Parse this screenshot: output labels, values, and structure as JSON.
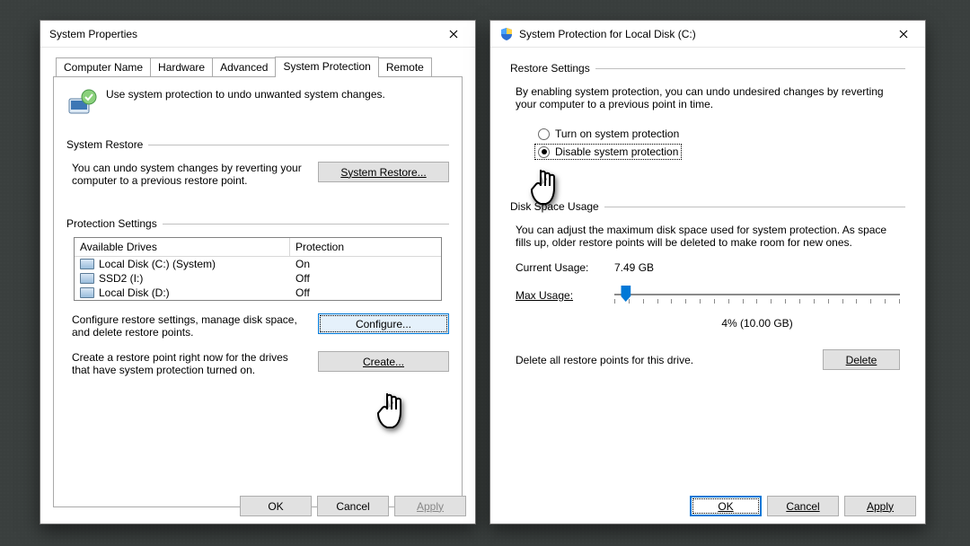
{
  "left": {
    "title": "System Properties",
    "tabs": [
      "Computer Name",
      "Hardware",
      "Advanced",
      "System Protection",
      "Remote"
    ],
    "selected_tab": "System Protection",
    "intro_text": "Use system protection to undo unwanted system changes.",
    "restore_group_label": "System Restore",
    "restore_text": "You can undo system changes by reverting your computer to a previous restore point.",
    "restore_button": "System Restore...",
    "protection_group_label": "Protection Settings",
    "table": {
      "headers": [
        "Available Drives",
        "Protection"
      ],
      "rows": [
        {
          "drive": "Local Disk (C:) (System)",
          "protection": "On"
        },
        {
          "drive": "SSD2 (I:)",
          "protection": "Off"
        },
        {
          "drive": "Local Disk (D:)",
          "protection": "Off"
        }
      ]
    },
    "configure_text": "Configure restore settings, manage disk space, and delete restore points.",
    "configure_button": "Configure...",
    "create_text": "Create a restore point right now for the drives that have system protection turned on.",
    "create_button": "Create...",
    "buttons": {
      "ok": "OK",
      "cancel": "Cancel",
      "apply": "Apply"
    }
  },
  "right": {
    "title": "System Protection for Local Disk (C:)",
    "restore_group_label": "Restore Settings",
    "restore_description": "By enabling system protection, you can undo undesired changes by reverting your computer to a previous point in time.",
    "radio_on": "Turn on system protection",
    "radio_off": "Disable system protection",
    "selected_radio": "off",
    "disk_group_label": "Disk Space Usage",
    "disk_description": "You can adjust the maximum disk space used for system protection. As space fills up, older restore points will be deleted to make room for new ones.",
    "current_usage_label": "Current Usage:",
    "current_usage_value": "7.49 GB",
    "max_usage_label": "Max Usage:",
    "max_usage_percent": 4,
    "max_usage_display": "4% (10.00 GB)",
    "delete_text": "Delete all restore points for this drive.",
    "delete_button": "Delete",
    "buttons": {
      "ok": "OK",
      "cancel": "Cancel",
      "apply": "Apply"
    }
  }
}
